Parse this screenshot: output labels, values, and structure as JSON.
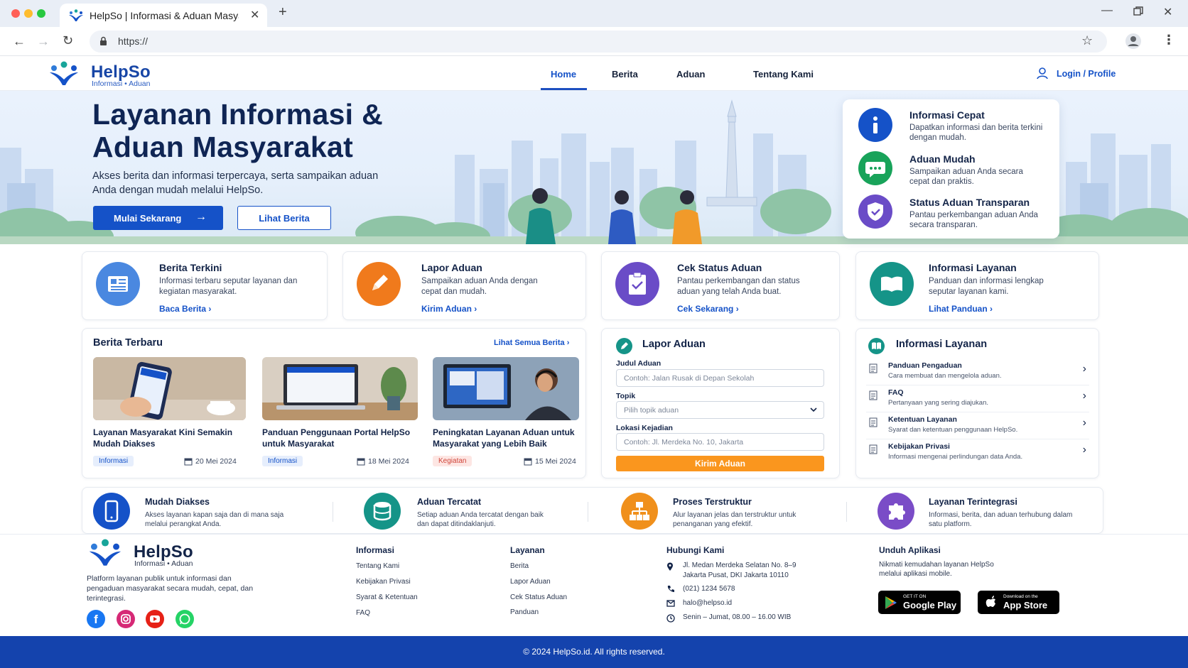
{
  "browser": {
    "tab_title": "HelpSo | Informasi & Aduan Masyarakat",
    "url": "https://"
  },
  "site": {
    "name": "HelpSo",
    "tagline": "Informasi • Aduan",
    "nav": [
      "Home",
      "Berita",
      "Aduan",
      "Tentang Kami"
    ],
    "login_label": "Login / Profile"
  },
  "hero": {
    "title_line1": "Layanan Informasi &",
    "title_line2": "Aduan Masyarakat",
    "subtitle": "Akses berita dan informasi terpercaya, serta sampaikan aduan Anda dengan mudah melalui HelpSo.",
    "primary_btn": "Mulai Sekarang",
    "secondary_btn": "Lihat Berita"
  },
  "features": [
    {
      "title": "Informasi Cepat",
      "desc": "Dapatkan informasi dan berita terkini dengan mudah.",
      "icon": "info-icon"
    },
    {
      "title": "Aduan Mudah",
      "desc": "Sampaikan aduan Anda secara cepat dan praktis.",
      "icon": "chat-icon"
    },
    {
      "title": "Status Aduan Transparan",
      "desc": "Pantau perkembangan aduan Anda secara transparan.",
      "icon": "shield-check-icon"
    }
  ],
  "services": [
    {
      "title": "Berita Terkini",
      "desc": "Informasi terbaru seputar layanan dan kegiatan masyarakat.",
      "link": "Baca Berita",
      "icon": "newspaper-icon",
      "color": "#4a88e0"
    },
    {
      "title": "Lapor Aduan",
      "desc": "Sampaikan aduan Anda dengan cepat dan mudah.",
      "link": "Kirim Aduan",
      "icon": "pencil-icon",
      "color": "#f07a1c"
    },
    {
      "title": "Cek Status Aduan",
      "desc": "Pantau perkembangan dan status aduan yang telah Anda buat.",
      "link": "Cek Sekarang",
      "icon": "clipboard-check-icon",
      "color": "#6a4cc7"
    },
    {
      "title": "Informasi Layanan",
      "desc": "Panduan dan informasi lengkap seputar layanan kami.",
      "link": "Lihat Panduan",
      "icon": "book-icon",
      "color": "#159488"
    }
  ],
  "news": {
    "title": "Berita Terbaru",
    "see_all": "Lihat Semua Berita",
    "items": [
      {
        "title": "Layanan Masyarakat Kini Semakin Mudah Diakses",
        "tag": "Informasi",
        "date": "20 Mei 2024"
      },
      {
        "title": "Panduan Penggunaan Portal HelpSo untuk Masyarakat",
        "tag": "Informasi",
        "date": "18 Mei 2024"
      },
      {
        "title": "Peningkatan Layanan Aduan untuk Masyarakat yang Lebih Baik",
        "tag": "Kegiatan",
        "date": "15 Mei 2024"
      }
    ]
  },
  "form": {
    "title": "Lapor Aduan",
    "judul_label": "Judul Aduan",
    "judul_placeholder": "Contoh: Jalan Rusak di Depan Sekolah",
    "topik_label": "Topik",
    "topik_value": "Pilih topik aduan",
    "lokasi_label": "Lokasi Kejadian",
    "lokasi_placeholder": "Contoh: Jl. Merdeka No. 10, Jakarta",
    "submit": "Kirim Aduan"
  },
  "info_layanan": {
    "title": "Informasi Layanan",
    "items": [
      {
        "title": "Panduan Pengaduan",
        "desc": "Cara membuat dan mengelola aduan."
      },
      {
        "title": "FAQ",
        "desc": "Pertanyaan yang sering diajukan."
      },
      {
        "title": "Ketentuan Layanan",
        "desc": "Syarat dan ketentuan penggunaan HelpSo."
      },
      {
        "title": "Kebijakan Privasi",
        "desc": "Informasi mengenai perlindungan data Anda."
      }
    ]
  },
  "benefits": [
    {
      "title": "Mudah Diakses",
      "desc": "Akses layanan kapan saja dan di mana saja melalui perangkat Anda.",
      "icon": "smartphone-icon",
      "color": "#1552c8"
    },
    {
      "title": "Aduan Tercatat",
      "desc": "Setiap aduan Anda tercatat dengan baik dan dapat ditindaklanjuti.",
      "icon": "database-icon",
      "color": "#159488"
    },
    {
      "title": "Proses Terstruktur",
      "desc": "Alur layanan jelas dan terstruktur untuk penanganan yang efektif.",
      "icon": "hierarchy-icon",
      "color": "#f0901c"
    },
    {
      "title": "Layanan Terintegrasi",
      "desc": "Informasi, berita, dan aduan terhubung dalam satu platform.",
      "icon": "puzzle-icon",
      "color": "#7a4cc7"
    }
  ],
  "footer": {
    "about": "Platform layanan publik untuk informasi dan pengaduan masyarakat secara mudah, cepat, dan terintegrasi.",
    "col_info_title": "Informasi",
    "col_info": [
      "Tentang Kami",
      "Kebijakan Privasi",
      "Syarat & Ketentuan",
      "FAQ"
    ],
    "col_layanan_title": "Layanan",
    "col_layanan": [
      "Berita",
      "Lapor Aduan",
      "Cek Status Aduan",
      "Panduan"
    ],
    "contact_title": "Hubungi Kami",
    "address": "Jl. Medan Merdeka Selatan No. 8–9 Jakarta Pusat, DKI Jakarta 10110",
    "phone": "(021) 1234 5678",
    "email": "halo@helpso.id",
    "hours": "Senin – Jumat, 08.00 – 16.00 WIB",
    "app_title": "Unduh Aplikasi",
    "app_desc": "Nikmati kemudahan layanan HelpSo melalui aplikasi mobile.",
    "google_small": "GET IT ON",
    "google_big": "Google Play",
    "apple_small": "Download on the",
    "apple_big": "App Store",
    "copyright": "© 2024 HelpSo.id. All rights reserved."
  }
}
